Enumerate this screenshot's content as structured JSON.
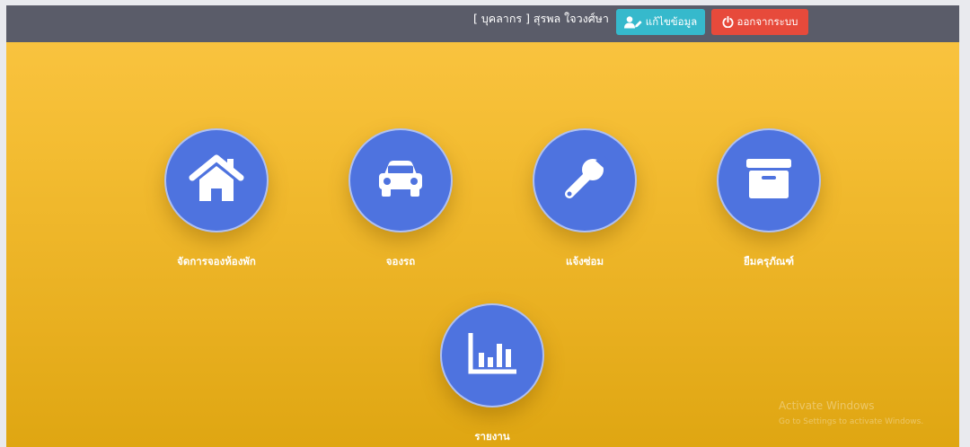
{
  "header": {
    "user_label": "[ บุคลากร ] สุรพล ใจวงศ์ษา",
    "edit_button": "แก้ไขข้อมูล",
    "logout_button": "ออกจากระบบ"
  },
  "menu": {
    "items": [
      {
        "label": "จัดการจองห้องพัก",
        "icon": "home-icon"
      },
      {
        "label": "จองรถ",
        "icon": "car-icon"
      },
      {
        "label": "แจ้งซ่อม",
        "icon": "wrench-icon"
      },
      {
        "label": "ยืมครุภัณฑ์",
        "icon": "archive-box-icon"
      },
      {
        "label": "รายงาน",
        "icon": "bar-chart-icon"
      }
    ]
  },
  "colors": {
    "topbar": "#5a5c69",
    "edit_button": "#36b9cc",
    "logout_button": "#e74a3b",
    "icon_circle": "#4e73df",
    "background_top": "#fbc543",
    "background_bottom": "#dfa612"
  },
  "watermark": {
    "line1": "Activate Windows",
    "line2": "Go to Settings to activate Windows."
  }
}
